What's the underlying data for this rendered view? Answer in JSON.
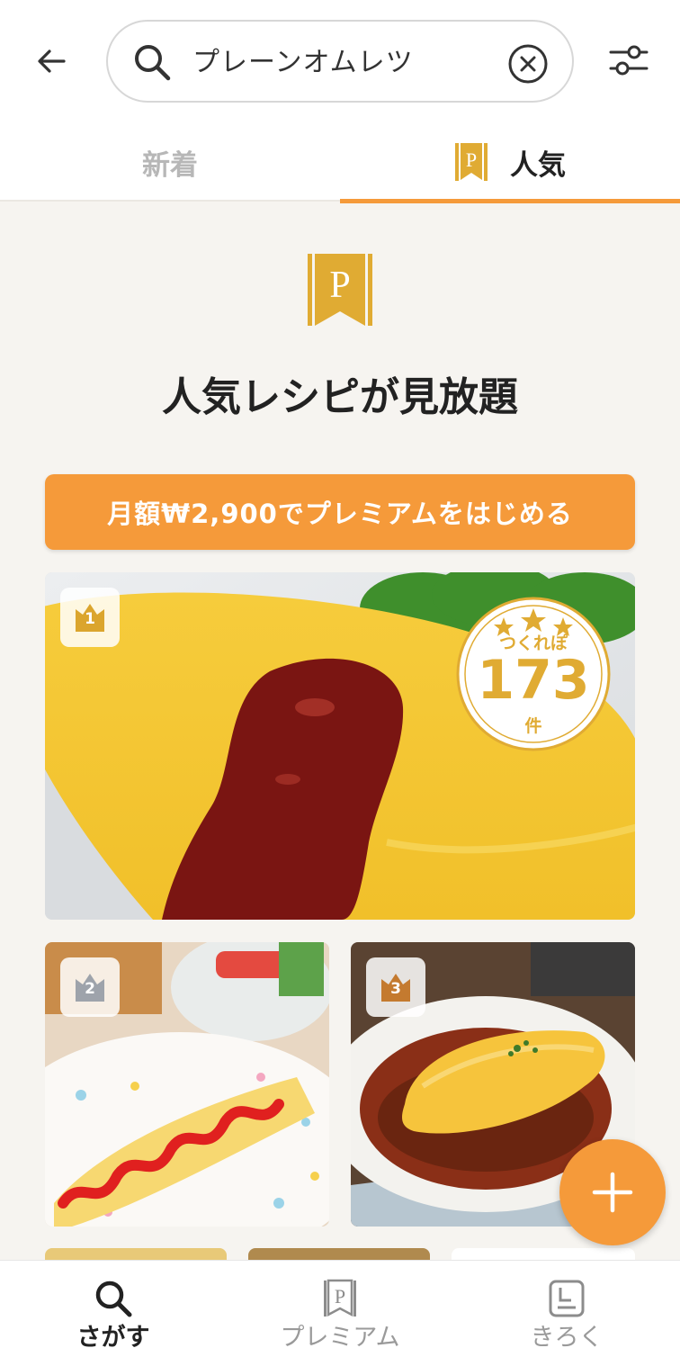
{
  "search": {
    "query": "プレーンオムレツ"
  },
  "tabs": [
    {
      "label": "新着",
      "active": false
    },
    {
      "label": "人気",
      "active": true
    }
  ],
  "promo": {
    "logo_letter": "P",
    "title": "人気レシピが見放題",
    "cta_label": "月額₩2,900でプレミアムをはじめる"
  },
  "recipes": [
    {
      "rank": "1",
      "tsukurepo_label": "つくれぽ",
      "tsukurepo_count": "173",
      "tsukurepo_unit": "件"
    },
    {
      "rank": "2"
    },
    {
      "rank": "3"
    }
  ],
  "bottom_nav": {
    "items": [
      {
        "label": "さがす",
        "icon": "search-icon",
        "active": true
      },
      {
        "label": "プレミアム",
        "icon": "premium-icon",
        "active": false
      },
      {
        "label": "きろく",
        "icon": "record-icon",
        "active": false
      }
    ]
  },
  "colors": {
    "accent": "#f59a3a",
    "gold": "#e0ab33",
    "background": "#f6f4f0",
    "rank_gold": "#dba52d",
    "rank_silver": "#9ea3ab",
    "rank_bronze": "#c47a2f"
  }
}
